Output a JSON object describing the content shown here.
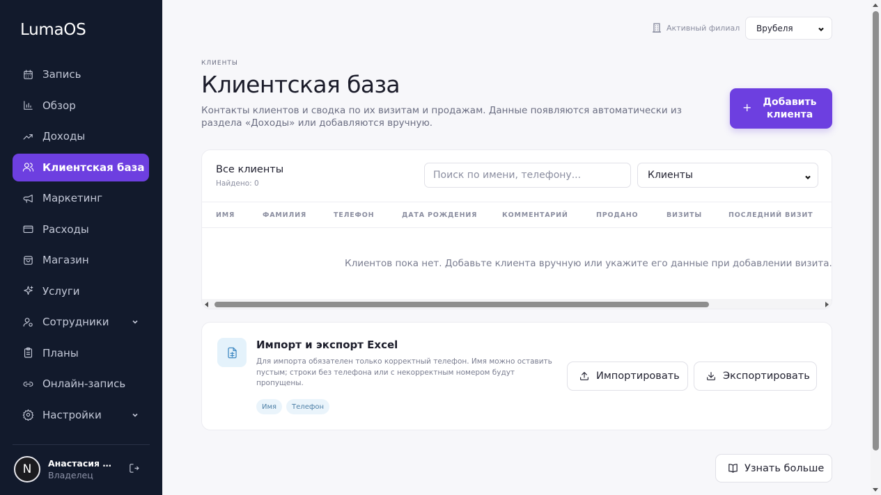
{
  "app": {
    "name": "LumaOS"
  },
  "sidebar": {
    "items": [
      {
        "label": "Запись",
        "icon": "calendar-icon",
        "active": false
      },
      {
        "label": "Обзор",
        "icon": "bar-chart-icon",
        "active": false
      },
      {
        "label": "Доходы",
        "icon": "trend-up-icon",
        "active": false
      },
      {
        "label": "Клиентская база",
        "icon": "users-icon",
        "active": true
      },
      {
        "label": "Маркетинг",
        "icon": "megaphone-icon",
        "active": false
      },
      {
        "label": "Расходы",
        "icon": "credit-card-icon",
        "active": false
      },
      {
        "label": "Магазин",
        "icon": "shopping-bag-icon",
        "active": false
      },
      {
        "label": "Услуги",
        "icon": "sparkles-icon",
        "active": false
      },
      {
        "label": "Сотрудники",
        "icon": "user-group-icon",
        "active": false,
        "expandable": true
      },
      {
        "label": "Планы",
        "icon": "clipboard-icon",
        "active": false
      },
      {
        "label": "Онлайн-запись",
        "icon": "link-icon",
        "active": false
      },
      {
        "label": "Настройки",
        "icon": "gear-icon",
        "active": false,
        "expandable": true
      }
    ]
  },
  "user": {
    "initial": "N",
    "name": "Анастасия Же...",
    "role": "Владелец"
  },
  "topbar": {
    "branch_label": "Активный филиал",
    "branch_value": "Врубеля"
  },
  "header": {
    "eyebrow": "КЛИЕНТЫ",
    "title": "Клиентская база",
    "description": "Контакты клиентов и сводка по их визитам и продажам. Данные появляются автоматически из раздела «Доходы» или добавляются вручную.",
    "add_button_plus": "+",
    "add_button_label": "Добавить клиента"
  },
  "clients": {
    "title": "Все клиенты",
    "found": "Найдено: 0",
    "search_placeholder": "Поиск по имени, телефону...",
    "filter_value": "Клиенты",
    "columns": [
      "ИМЯ",
      "ФАМИЛИЯ",
      "ТЕЛЕФОН",
      "ДАТА РОЖДЕНИЯ",
      "КОММЕНТАРИЙ",
      "ПРОДАНО",
      "ВИЗИТЫ",
      "ПОСЛЕДНИЙ ВИЗИТ"
    ],
    "rows": [],
    "empty_message": "Клиентов пока нет. Добавьте клиента вручную или укажите его данные при добавлении визита."
  },
  "import_export": {
    "title": "Импорт и экспорт Excel",
    "description": "Для импорта обязателен только корректный телефон. Имя можно оставить пустым; строки без телефона или с некорректным номером будут пропущены.",
    "tags": [
      "Имя",
      "Телефон"
    ],
    "import_label": "Импортировать",
    "export_label": "Экспортировать"
  },
  "learn_more": "Узнать больше",
  "colors": {
    "sidebar_bg": "#121a2c",
    "accent": "#6d3fe0",
    "page_bg": "#f7f7fa",
    "tag_bg": "#eaf4fb"
  }
}
